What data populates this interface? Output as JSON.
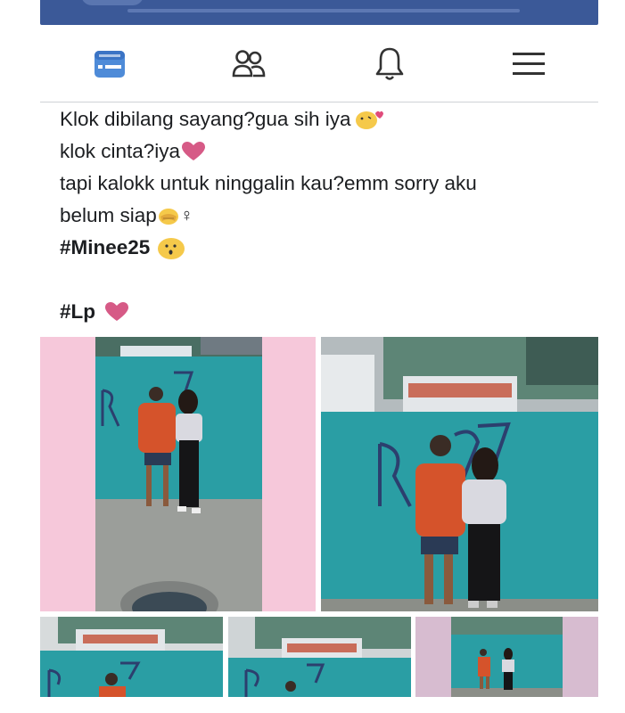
{
  "nav": {
    "items": [
      {
        "name": "news-feed-icon",
        "active": true
      },
      {
        "name": "friends-icon",
        "active": false
      },
      {
        "name": "notifications-icon",
        "active": false
      },
      {
        "name": "menu-icon",
        "active": false
      }
    ]
  },
  "post": {
    "lines": [
      "Klok dibilang sayang?gua sih iya",
      "klok cinta?iya",
      "tapi kalokk untuk ninggalin kau?emm sorry aku",
      "belum siap",
      "#Minee25",
      "#Lp"
    ],
    "female_sign": "♀"
  },
  "colors": {
    "brand": "#3b5998",
    "wall": "#2a9ea4",
    "pink": "#f6c8da",
    "heart": "#d65a86"
  }
}
